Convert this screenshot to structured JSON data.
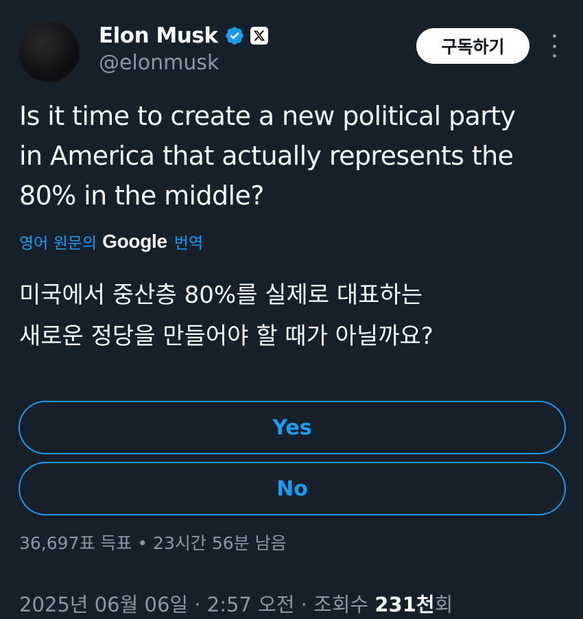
{
  "author": {
    "display_name": "Elon Musk",
    "handle": "@elonmusk",
    "verified_icon": "verified-badge-icon",
    "affiliation_icon": "x-logo-icon"
  },
  "header": {
    "subscribe_label": "구독하기",
    "more_icon": "more-options-icon"
  },
  "tweet": {
    "lines": [
      "Is it time to create a new political party",
      "in America that actually represents the",
      "80% in the middle?"
    ]
  },
  "translation": {
    "prefix": "영어 원문의",
    "brand": "Google",
    "suffix": "번역",
    "lines": [
      "미국에서 중산층 80%를 실제로 대표하는",
      "새로운 정당을 만들어야 할 때가 아닐까요?"
    ]
  },
  "poll": {
    "options": [
      "Yes",
      "No"
    ],
    "meta": "36,697표 득표 • 23시간 56분 남음"
  },
  "timestamp": {
    "date": "2025년 06월 06일",
    "separator1": " · ",
    "time": "2:57 오전",
    "separator2": " · ",
    "views_prefix": "조회수 ",
    "views_count": "231천",
    "views_suffix": "회"
  },
  "colors": {
    "background": "#15202b",
    "accent": "#1d9bf0",
    "secondary_text": "#8b98a5",
    "primary_text": "#f7f9f9"
  }
}
